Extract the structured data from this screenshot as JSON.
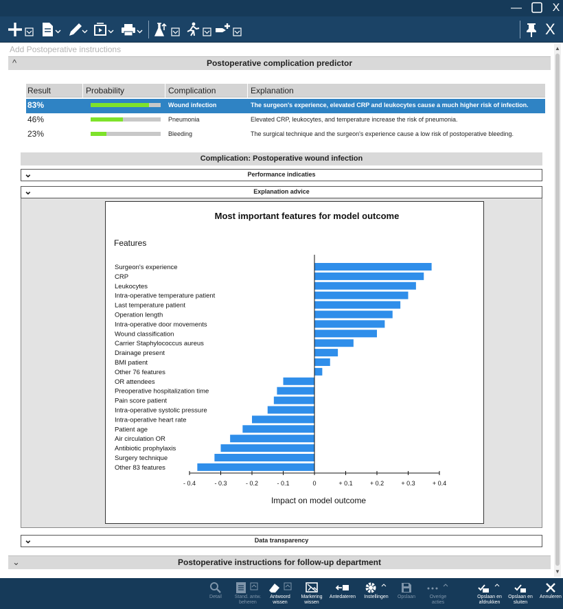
{
  "window": {
    "minimize": "—",
    "close": "X"
  },
  "toolbar": {
    "pin_label": "",
    "close_label": "X",
    "icons": [
      "plus-icon",
      "document-icon",
      "pen-icon",
      "media-icon",
      "printer-icon",
      "flask-icon",
      "walking-icon",
      "add-location-icon"
    ]
  },
  "content": {
    "add_instructions_placeholder": "Add Postoperative instructions",
    "predictor_title": "Postoperative complication predictor",
    "table": {
      "headers": [
        "Result",
        "Probability",
        "Complication",
        "Explanation"
      ],
      "rows": [
        {
          "result": "83%",
          "probability": 0.83,
          "complication": "Wound infection",
          "explanation": "The surgeon's experience, elevated CRP and leukocytes cause a much higher risk of infection.",
          "selected": true
        },
        {
          "result": "46%",
          "probability": 0.46,
          "complication": "Pneumonia",
          "explanation": "Elevated CRP, leukocytes, and temperature increase the risk of pneumonia.",
          "selected": false
        },
        {
          "result": "23%",
          "probability": 0.23,
          "complication": "Bleeding",
          "explanation": "The surgical technique and the surgeon's experience cause a low risk of postoperative bleeding.",
          "selected": false
        }
      ]
    },
    "complication_title": "Complication: Postoperative wound infection",
    "performance_title": "Performance indicaties",
    "explanation_title": "Explanation advice",
    "data_transparency_title": "Data transparency",
    "followup_title": "Postoperative instructions for follow-up department"
  },
  "chart_data": {
    "type": "bar",
    "orientation": "horizontal",
    "title": "Most important features for model outcome",
    "ylabel": "Features",
    "xlabel": "Impact on model outcome",
    "xlim": [
      -0.4,
      0.4
    ],
    "xticks": [
      "- 0.4",
      "- 0.3",
      "- 0.2",
      "- 0.1",
      "0",
      "+ 0.1",
      "+ 0.2",
      "+ 0.3",
      "+ 0.4"
    ],
    "xtick_values": [
      -0.4,
      -0.3,
      -0.2,
      -0.1,
      0,
      0.1,
      0.2,
      0.3,
      0.4
    ],
    "bar_color": "#2f8eea",
    "categories": [
      "Surgeon's experience",
      "CRP",
      "Leukocytes",
      "Intra-operative temperature patient",
      "Last temperature patient",
      "Operation length",
      "Intra-operative door movements",
      "Wound classification",
      "Carrier Staphylococcus aureus",
      "Drainage present",
      "BMI patient",
      "Other 76 features",
      "OR attendees",
      "Preoperative hospitalization time",
      "Pain score patient",
      "Intra-operative systolic pressure",
      "Intra-operative heart rate",
      "Patient age",
      "Air circulation OR",
      "Antibiotic prophylaxis",
      "Surgery technique",
      "Other 83 features"
    ],
    "values": [
      0.375,
      0.35,
      0.325,
      0.3,
      0.275,
      0.25,
      0.225,
      0.2,
      0.125,
      0.075,
      0.05,
      0.025,
      -0.1,
      -0.12,
      -0.13,
      -0.15,
      -0.2,
      -0.23,
      -0.27,
      -0.3,
      -0.32,
      -0.375
    ]
  },
  "bottombar": {
    "items": [
      {
        "icon": "search-icon",
        "label": "Detail",
        "enabled": false
      },
      {
        "icon": "list-icon",
        "label": "Stand. antw. beheren",
        "enabled": false
      },
      {
        "icon": "eraser-icon",
        "label": "Antwoord wissen",
        "enabled": true
      },
      {
        "icon": "highlight-clear-icon",
        "label": "Markering wissen",
        "enabled": true
      },
      {
        "icon": "date-arrow-icon",
        "label": "Antedateren",
        "enabled": true
      },
      {
        "icon": "gear-icon",
        "label": "Instellingen",
        "enabled": true
      },
      {
        "icon": "save-icon",
        "label": "Opslaan",
        "enabled": false
      },
      {
        "icon": "more-icon",
        "label": "Overige acties",
        "enabled": false
      },
      {
        "icon": "save-print-icon",
        "label": "Opslaan en afdrukken",
        "enabled": true
      },
      {
        "icon": "save-close-icon",
        "label": "Opslaan en sluiten",
        "enabled": true
      },
      {
        "icon": "cancel-icon",
        "label": "Annuleren",
        "enabled": true
      }
    ]
  }
}
